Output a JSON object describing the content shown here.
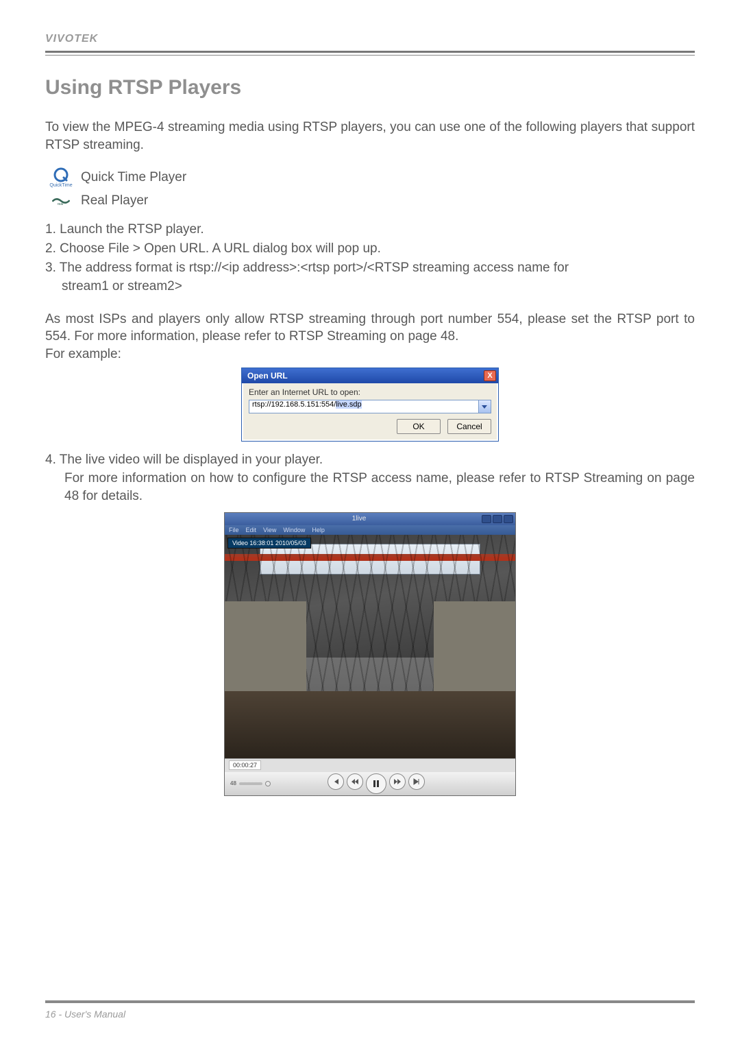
{
  "header": {
    "brand": "VIVOTEK"
  },
  "section": {
    "title": "Using RTSP Players"
  },
  "intro": "To view the MPEG-4 streaming media using RTSP players, you can use one of the following players that support RTSP streaming.",
  "players": {
    "quicktime": "Quick Time Player",
    "real": "Real Player"
  },
  "steps": {
    "s1": "1. Launch the RTSP player.",
    "s2": "2. Choose File > Open URL. A URL dialog box will pop up.",
    "s3": "3. The address format is rtsp://<ip address>:<rtsp port>/<RTSP streaming access name for",
    "s3b": "stream1 or stream2>"
  },
  "isp_para_a": "As most ISPs and players only allow RTSP streaming through port number 554, please set the RTSP port to 554. For more information, ",
  "isp_link": "please refer to RTSP Streaming on page 48.",
  "isp_para_b": "For example:",
  "dialog": {
    "title": "Open URL",
    "label": "Enter an Internet URL to open:",
    "url_prefix": "rtsp://192.168.5.151:554/",
    "url_selected": "live.sdp",
    "ok": "OK",
    "cancel": "Cancel"
  },
  "step4": {
    "line": "4. The live video will be displayed in your player.",
    "sub": "For more information on how to configure the RTSP access name, please refer to RTSP Streaming on page 48 for details."
  },
  "playershot": {
    "title": "1live",
    "menu": {
      "file": "File",
      "edit": "Edit",
      "view": "View",
      "window": "Window",
      "help": "Help"
    },
    "overlay": "Video 16:38:01 2010/05/03",
    "time": "00:00:27",
    "vol": "48"
  },
  "footer": {
    "page": "16 - User's Manual"
  }
}
